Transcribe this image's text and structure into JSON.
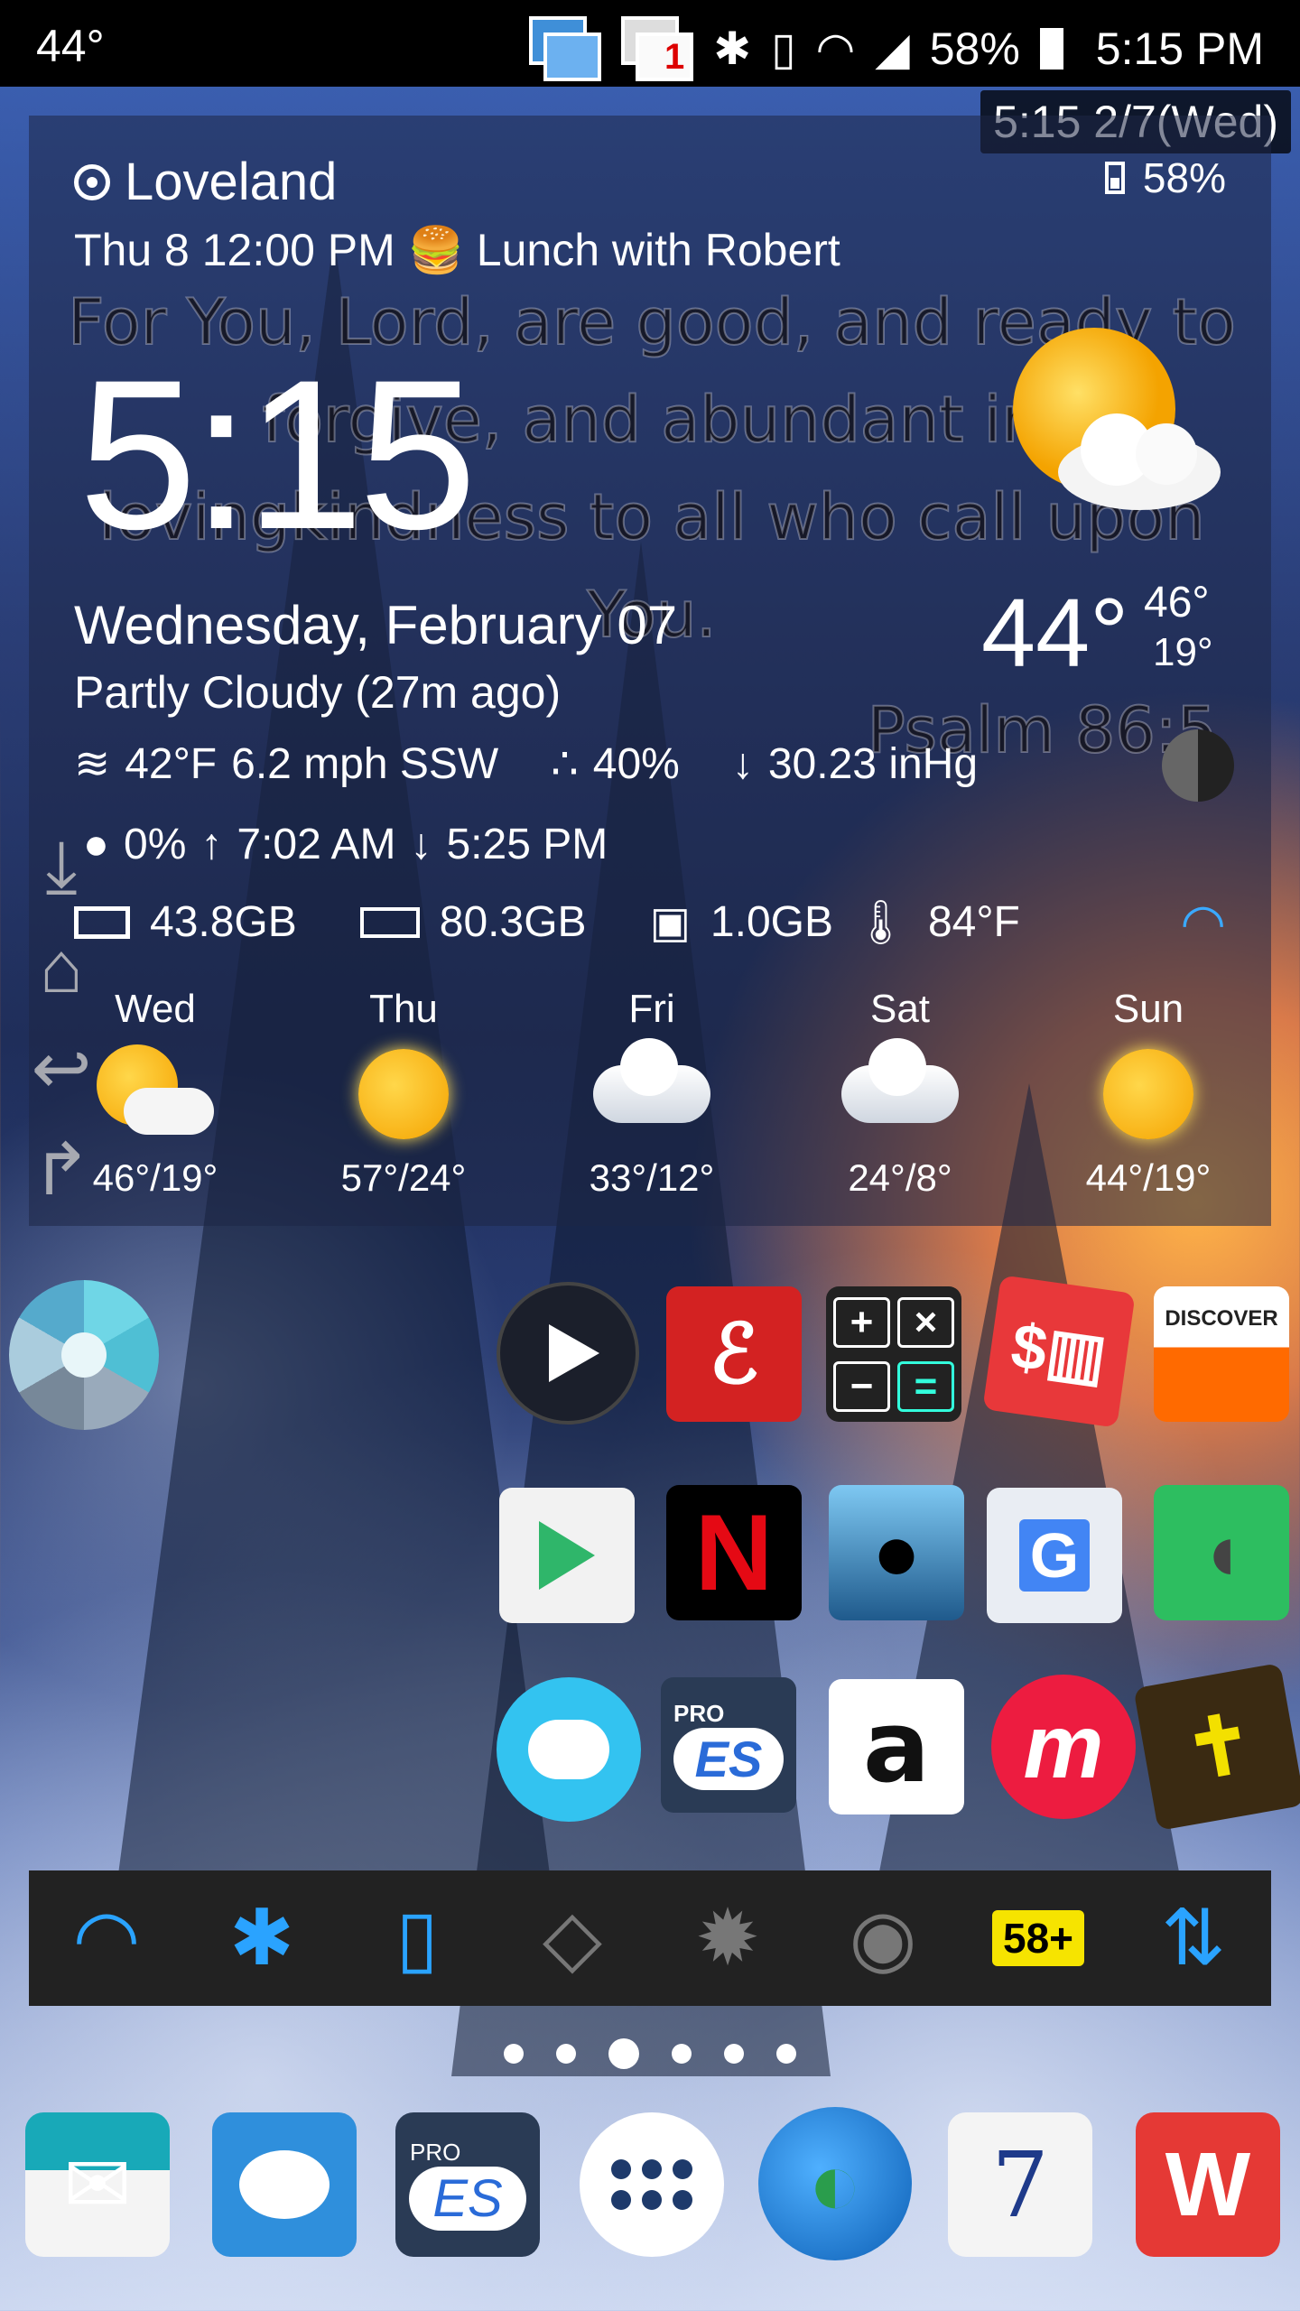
{
  "status_bar": {
    "temperature": "44°",
    "notif_count": "1",
    "battery": "58%",
    "time": "5:15 PM"
  },
  "date_bubble": "5:15 2/7(Wed)",
  "widget": {
    "location": "Loveland",
    "battery": "58%",
    "event": "Thu 8 12:00 PM 🍔 Lunch with Robert",
    "verse": "For You, Lord, are good, and ready to forgive, and abundant in lovingkindness to all who call upon You.",
    "verse_ref": "Psalm 86:5",
    "clock": "5:15",
    "date": "Wednesday, February 07",
    "condition": "Partly Cloudy  (27m ago)",
    "temp": "44°",
    "high": "46°",
    "low": "19°",
    "feels": "42°F",
    "wind": "6.2 mph SSW",
    "humidity": "40%",
    "pressure": "30.23 inHg",
    "precip": "0%",
    "sunrise": "7:02 AM",
    "sunset": "5:25 PM",
    "storage1": "43.8GB",
    "storage2": "80.3GB",
    "ram": "1.0GB",
    "cpu_temp": "84°F",
    "forecast": [
      {
        "day": "Wed",
        "temps": "46°/19°",
        "icon": "partly-cloudy-icon"
      },
      {
        "day": "Thu",
        "temps": "57°/24°",
        "icon": "sunny-icon"
      },
      {
        "day": "Fri",
        "temps": "33°/12°",
        "icon": "cloudy-icon"
      },
      {
        "day": "Sat",
        "temps": "24°/8°",
        "icon": "snow-icon"
      },
      {
        "day": "Sun",
        "temps": "44°/19°",
        "icon": "sunny-icon"
      }
    ]
  },
  "apps": {
    "discover": "DISCOVER",
    "netflix": "N",
    "amazon": "a",
    "es_pro": "PRO",
    "es_label": "ES",
    "calendar_day": "7",
    "meetup": "m"
  },
  "toggles": {
    "battery_badge": "58+"
  }
}
